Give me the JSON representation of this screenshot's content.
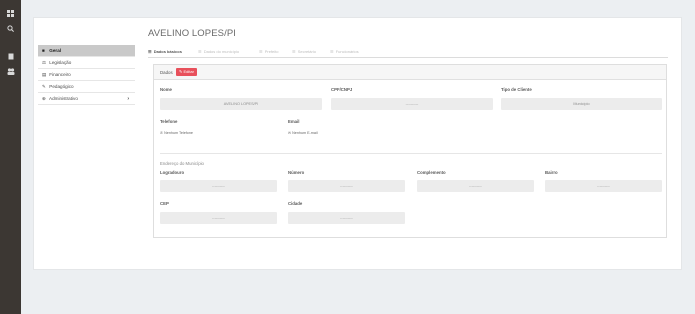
{
  "sidebar_icons": [
    "grid-icon",
    "search-icon",
    "document-icon",
    "users-icon"
  ],
  "menu": {
    "items": [
      {
        "label": "Geral",
        "icon": "■",
        "active": true
      },
      {
        "label": "Legislação",
        "icon": "⚖",
        "active": false
      },
      {
        "label": "Financeiro",
        "icon": "▤",
        "active": false
      },
      {
        "label": "Pedagógico",
        "icon": "✎",
        "active": false
      },
      {
        "label": "Administrativo",
        "icon": "⊕",
        "active": false,
        "has_submenu": true
      }
    ]
  },
  "page": {
    "title": "AVELINO LOPES/PI"
  },
  "tabs": [
    {
      "label": "Dados básicos",
      "active": true
    },
    {
      "label": "Dados do município",
      "active": false
    },
    {
      "label": "Prefeito",
      "active": false
    },
    {
      "label": "Secretário",
      "active": false
    },
    {
      "label": "Funcionários",
      "active": false
    }
  ],
  "panel": {
    "title": "Dados",
    "edit_label": "Editar",
    "fields": {
      "nome_label": "Nome",
      "nome_value": "AVELINO LOPES/PI",
      "cpf_label": "CPF/CNPJ",
      "cpf_value": "----------",
      "tipo_label": "Tipo de Cliente",
      "tipo_value": "Município",
      "telefone_label": "Telefone",
      "telefone_value": "Nenhum Telefone",
      "email_label": "Email",
      "email_value": "Nenhum E-mail",
      "endereco_label": "Endereço do Município",
      "logradouro_label": "Logradouro",
      "logradouro_value": "----------",
      "numero_label": "Número",
      "numero_value": "----------",
      "complemento_label": "Complemento",
      "complemento_value": "----------",
      "bairro_label": "Bairro",
      "bairro_value": "----------",
      "cep_label": "CEP",
      "cep_value": "----------",
      "cidade_label": "Cidade",
      "cidade_value": "----------"
    }
  },
  "colors": {
    "sidebar": "#3c3733",
    "accent": "#e8505b",
    "active_menu": "#c9c9c9"
  }
}
